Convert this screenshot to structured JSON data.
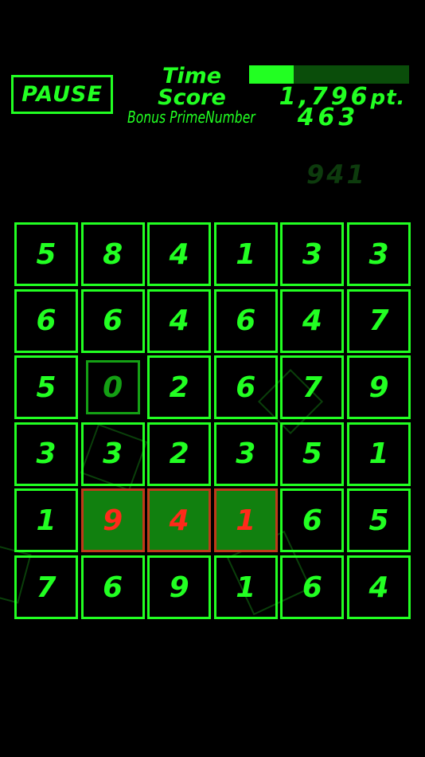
{
  "pause_label": "PAUSE",
  "hud": {
    "time_label": "Time",
    "score_label": "Score",
    "bonus_label": "Bonus PrimeNumber",
    "time_remaining_fraction": 0.28,
    "score_value": "1,796",
    "score_unit": "pt.",
    "bonus_value": "463",
    "last_prime": "941"
  },
  "board": {
    "rows": [
      [
        "5",
        "8",
        "4",
        "1",
        "3",
        "3"
      ],
      [
        "6",
        "6",
        "4",
        "6",
        "4",
        "7"
      ],
      [
        "5",
        "0",
        "2",
        "6",
        "7",
        "9"
      ],
      [
        "3",
        "3",
        "2",
        "3",
        "5",
        "1"
      ],
      [
        "1",
        "9",
        "4",
        "1",
        "6",
        "5"
      ],
      [
        "7",
        "6",
        "9",
        "1",
        "6",
        "4"
      ]
    ],
    "selected": [
      [
        4,
        1
      ],
      [
        4,
        2
      ],
      [
        4,
        3
      ]
    ],
    "dimmed": [
      [
        2,
        1
      ]
    ]
  },
  "colors": {
    "green": "#22ff22",
    "selected_fill": "#11800f",
    "selected_text": "#ff2a1a"
  }
}
